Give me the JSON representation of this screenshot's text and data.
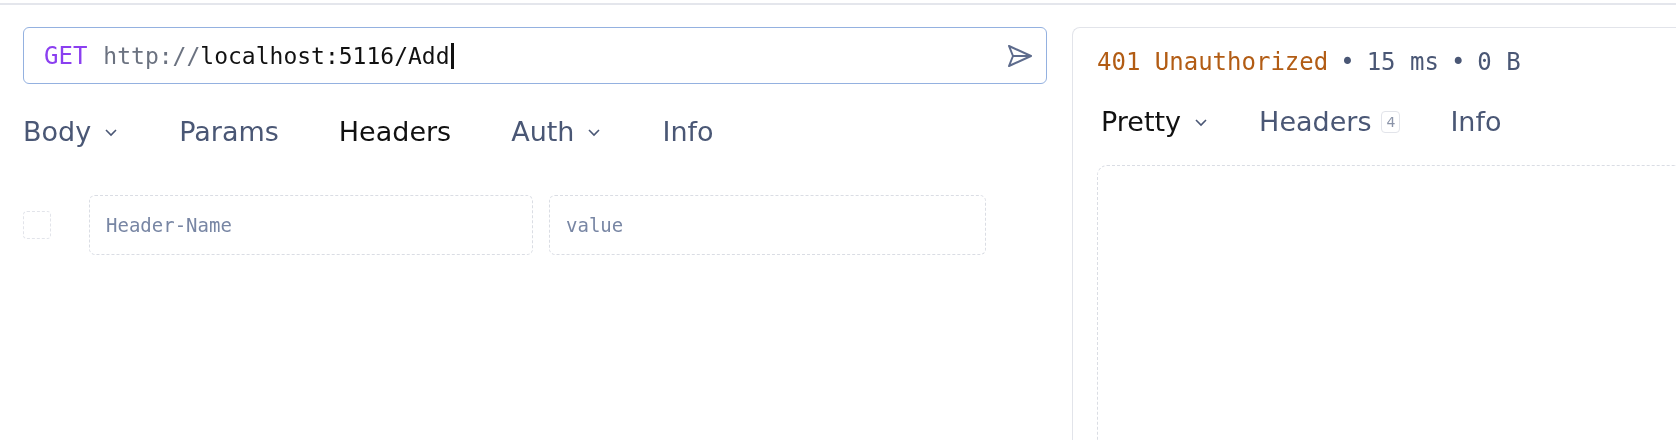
{
  "request": {
    "method": "GET",
    "url_scheme": "http://",
    "url_rest": "localhost:5116/Add",
    "tabs": [
      {
        "label": "Body",
        "selected": false,
        "dropdown": true
      },
      {
        "label": "Params",
        "selected": false,
        "dropdown": false
      },
      {
        "label": "Headers",
        "selected": true,
        "dropdown": false
      },
      {
        "label": "Auth",
        "selected": false,
        "dropdown": true
      },
      {
        "label": "Info",
        "selected": false,
        "dropdown": false
      }
    ],
    "header_rows": [
      {
        "checked": false,
        "name_placeholder": "Header-Name",
        "value_placeholder": "value"
      }
    ]
  },
  "response": {
    "status": "401 Unauthorized",
    "separator": "•",
    "time": "15 ms",
    "size": "0 B",
    "tabs": [
      {
        "label": "Pretty",
        "selected": true,
        "dropdown": true
      },
      {
        "label": "Headers",
        "selected": false,
        "dropdown": false,
        "count": "4"
      },
      {
        "label": "Info",
        "selected": false,
        "dropdown": false
      }
    ]
  }
}
